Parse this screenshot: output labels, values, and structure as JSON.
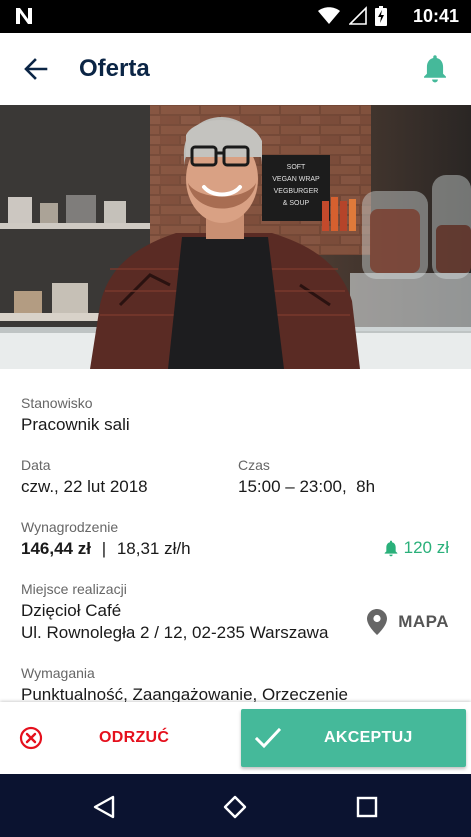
{
  "status_bar": {
    "time": "10:41"
  },
  "app_bar": {
    "title": "Oferta"
  },
  "hero": {
    "chalkboard_lines": [
      "SOFT",
      "VEGAN WRAP",
      "VEGBURGER",
      "& SOUP"
    ]
  },
  "details": {
    "position": {
      "label": "Stanowisko",
      "value": "Pracownik sali"
    },
    "date": {
      "label": "Data",
      "value": "czw., 22 lut 2018"
    },
    "time": {
      "label": "Czas",
      "value": "15:00 – 23:00,  8h"
    },
    "pay": {
      "label": "Wynagrodzenie",
      "total": "146,44 zł",
      "separator": "|",
      "hourly": "18,31 zł/h",
      "bonus": "120 zł"
    },
    "location": {
      "label": "Miejsce realizacji",
      "name": "Dzięcioł Café",
      "address": "Ul. Rownoległa 2 / 12, 02-235 Warszawa",
      "map_label": "MAPA"
    },
    "requirements": {
      "label": "Wymagania",
      "value": "Punktualność, Zaangażowanie, Orzeczenie"
    }
  },
  "actions": {
    "reject_label": "ODRZUĆ",
    "accept_label": "AKCEPTUJ"
  },
  "colors": {
    "accent": "#45b99a",
    "bonus": "#2ab07a",
    "reject": "#e5101d",
    "title": "#0b2545",
    "nav_bar": "#0b1330"
  },
  "icons": {
    "status_logo": "n-logo-icon",
    "wifi": "wifi-icon",
    "signal": "signal-icon",
    "battery": "battery-icon",
    "back": "arrow-left-icon",
    "bell": "bell-icon",
    "bonus": "bell-icon",
    "map": "map-pin-icon",
    "reject": "close-circle-icon",
    "accept": "check-icon",
    "nav_back": "triangle-back-icon",
    "nav_home": "home-icon",
    "nav_recents": "square-icon"
  }
}
